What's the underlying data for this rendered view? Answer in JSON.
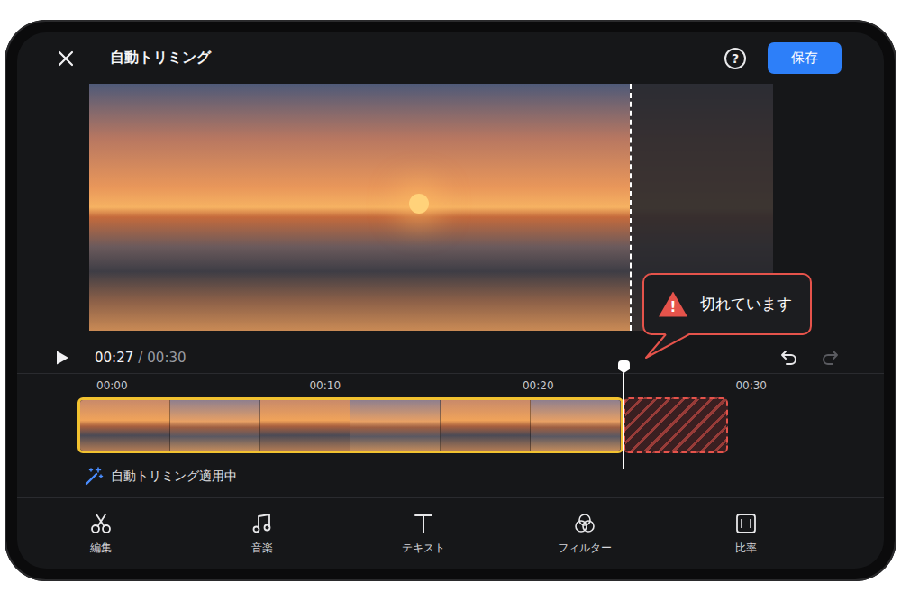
{
  "topbar": {
    "title": "自動トリミング",
    "help": "?",
    "save": "保存"
  },
  "preview": {
    "visible_level": 0.79
  },
  "warning": {
    "icon": "!",
    "text": "切れています"
  },
  "playback": {
    "playing": false,
    "current": "00:27",
    "separator": "/",
    "total": "00:30"
  },
  "history": {
    "undo_enabled": true,
    "redo_enabled": false
  },
  "timeline": {
    "ticks": [
      "00:00",
      "00:10",
      "00:20",
      "00:30"
    ],
    "frames": 6,
    "kept_level": 0.84,
    "playhead_level": 0.84
  },
  "status": {
    "text": "自動トリミング適用中",
    "active": true
  },
  "toolbar": [
    {
      "label": "編集",
      "kind": "scissors"
    },
    {
      "label": "音楽",
      "kind": "music"
    },
    {
      "label": "テキスト",
      "kind": "text"
    },
    {
      "label": "フィルター",
      "kind": "filter"
    },
    {
      "label": "比率",
      "kind": "ratio"
    }
  ]
}
